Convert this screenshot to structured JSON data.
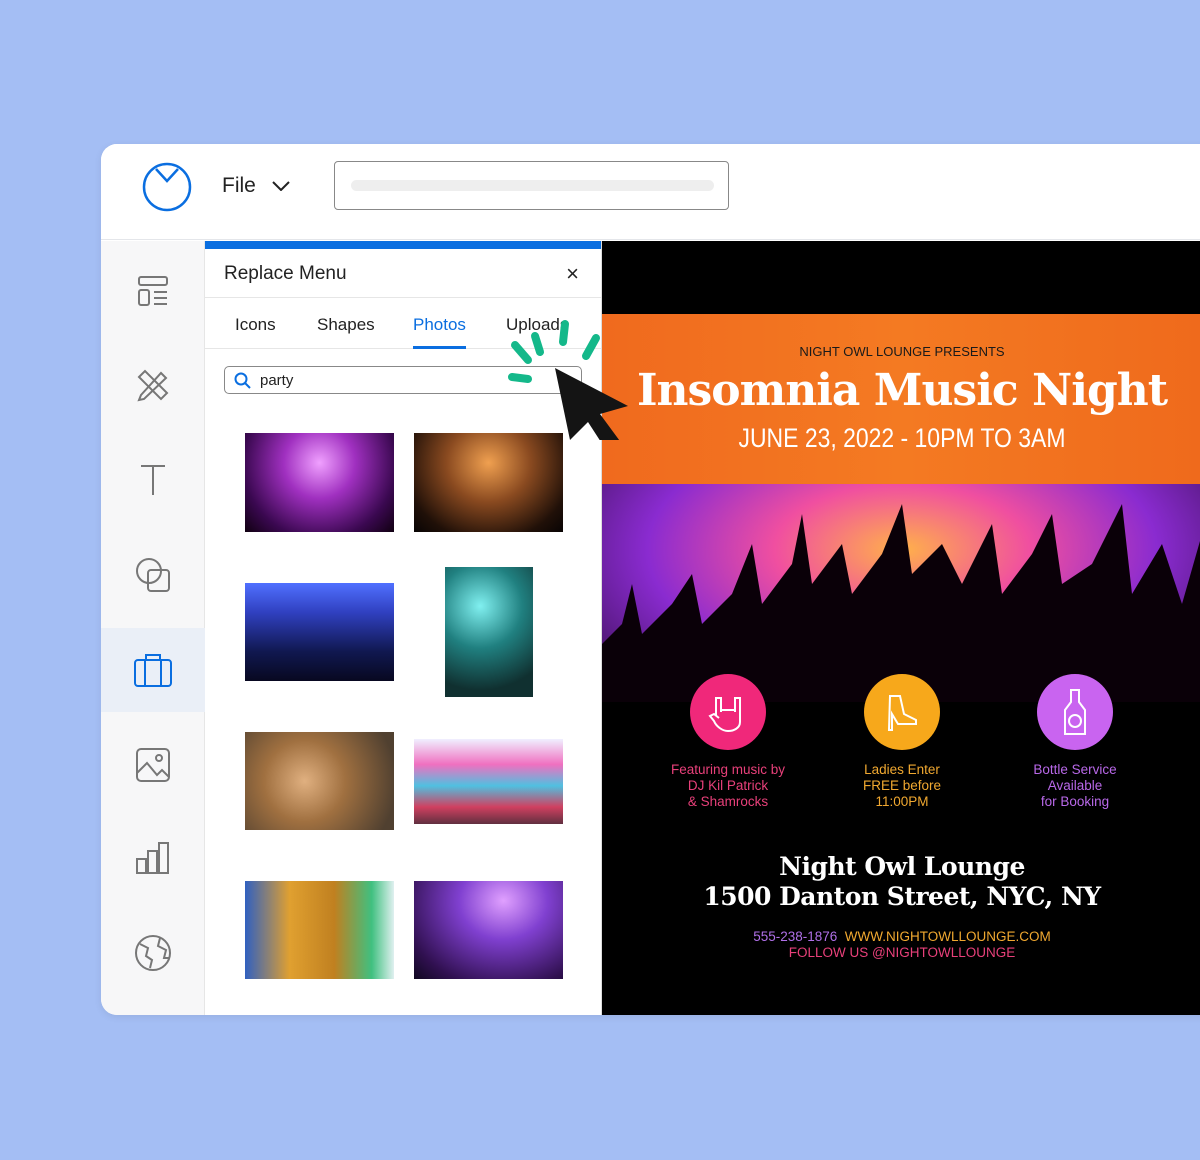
{
  "header": {
    "file_label": "File",
    "logo_icon": "clock-logo-icon",
    "chevron_icon": "chevron-down-icon"
  },
  "sidebar": {
    "items": [
      {
        "name": "templates",
        "icon": "layout-icon"
      },
      {
        "name": "design",
        "icon": "pencil-ruler-icon"
      },
      {
        "name": "text",
        "icon": "text-icon"
      },
      {
        "name": "shapes",
        "icon": "shapes-icon"
      },
      {
        "name": "graphics",
        "icon": "briefcase-icon",
        "active": true
      },
      {
        "name": "photos",
        "icon": "image-icon"
      },
      {
        "name": "charts",
        "icon": "bar-chart-icon"
      },
      {
        "name": "maps",
        "icon": "globe-icon"
      }
    ]
  },
  "panel": {
    "title": "Replace Menu",
    "close": "×",
    "tabs": [
      {
        "label": "Icons"
      },
      {
        "label": "Shapes"
      },
      {
        "label": "Photos",
        "active": true
      },
      {
        "label": "Uploads"
      }
    ],
    "search_value": "party",
    "photos": [
      "fireworks-crowd",
      "concert-crowd",
      "blue-party-lights",
      "sparkler",
      "champagne-toast",
      "color-powder-festival",
      "pineapples-party-hats",
      "purple-concert-hands"
    ]
  },
  "poster": {
    "presents": "NIGHT OWL LOUNGE PRESENTS",
    "title": "Insomnia Music Night",
    "date": "JUNE 23, 2022 - 10PM TO 3AM",
    "features": [
      {
        "icon": "rock-hand-icon",
        "color": "#f0287a",
        "text_color": "#e8407a",
        "lines": [
          "Featuring music by",
          "DJ Kil Patrick",
          "& Shamrocks"
        ]
      },
      {
        "icon": "high-heel-icon",
        "color": "#f7a81b",
        "text_color": "#f0a830",
        "lines": [
          "Ladies Enter",
          "FREE before",
          "11:00PM"
        ]
      },
      {
        "icon": "bottle-icon",
        "color": "#c964f0",
        "text_color": "#b868e8",
        "lines": [
          "Bottle Service",
          "Available",
          "for Booking"
        ]
      }
    ],
    "venue": "Night Owl Lounge",
    "address": "1500 Danton Street, NYC, NY",
    "phone": "555-238-1876",
    "website": "WWW.NIGHTOWLLOUNGE.COM",
    "social": "FOLLOW US @NIGHTOWLLOUNGE"
  },
  "colors": {
    "accent": "#0a6ee0",
    "background": "#a4bef4",
    "click_marks": "#14b88a"
  }
}
